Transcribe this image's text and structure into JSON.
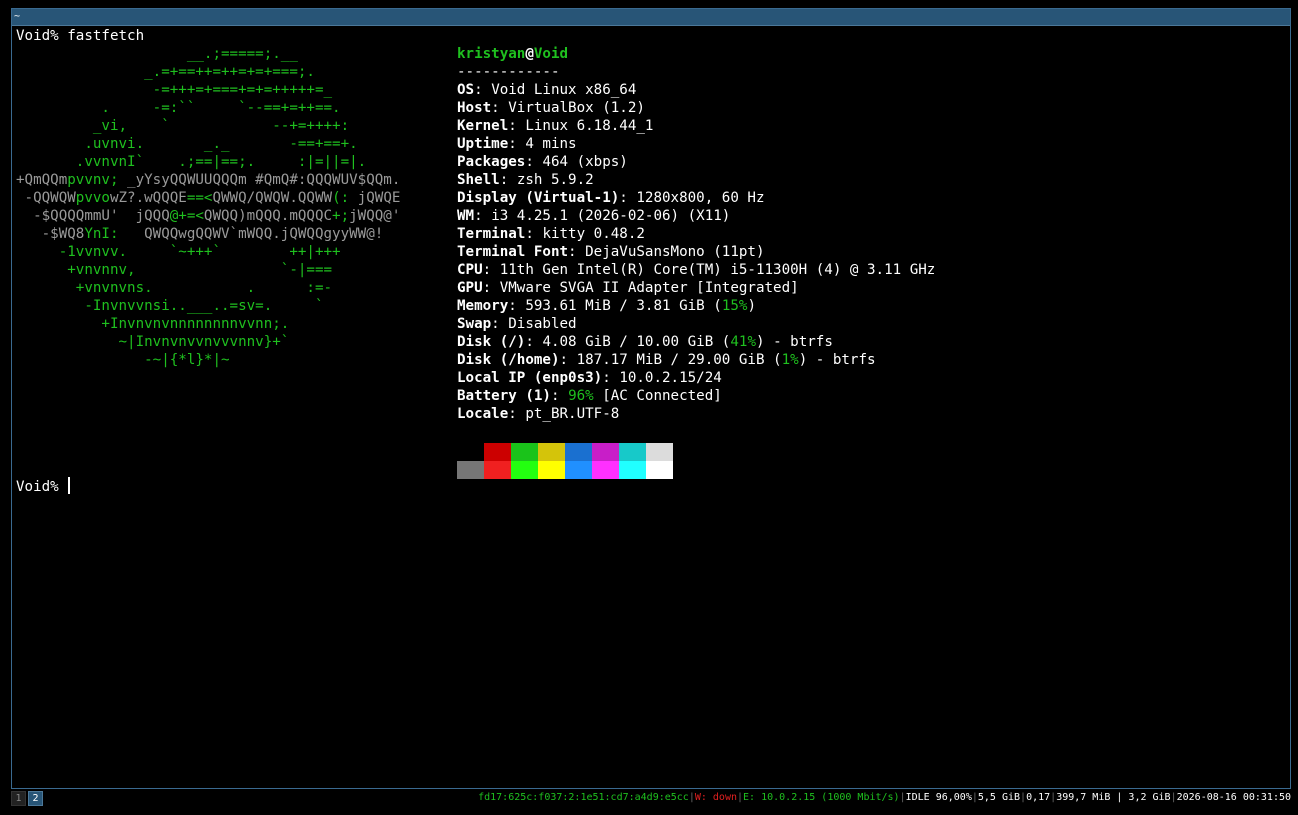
{
  "window": {
    "title": "~"
  },
  "terminal": {
    "prompt": "Void%",
    "command": "fastfetch",
    "prompt2": "Void%",
    "logo": [
      [
        {
          "t": "                    __.;=====;.__",
          "c": "g"
        }
      ],
      [
        {
          "t": "               _.=+==++=++=+=+===;.",
          "c": "g"
        }
      ],
      [
        {
          "t": "                -=+++=+===+=+=+++++=_",
          "c": "g"
        }
      ],
      [
        {
          "t": "          .     -=:``     `--==+=++==.",
          "c": "g"
        }
      ],
      [
        {
          "t": "         _vi,    `            --+=++++:",
          "c": "g"
        }
      ],
      [
        {
          "t": "        .uvnvi.       _._       -==+==+.",
          "c": "g"
        }
      ],
      [
        {
          "t": "       .vvnvnI`    .;==|==;.     :|=||=|.",
          "c": "g"
        }
      ],
      [
        {
          "t": "+QmQQm",
          "c": "w"
        },
        {
          "t": "pvvnv;",
          "c": "g"
        },
        {
          "t": " _yYsyQQWUUQQQm #QmQ#:QQQWUV$QQm.",
          "c": "w"
        }
      ],
      [
        {
          "t": " -QQWQW",
          "c": "w"
        },
        {
          "t": "pvvo",
          "c": "g"
        },
        {
          "t": "wZ?.wQQQE",
          "c": "w"
        },
        {
          "t": "==<",
          "c": "g"
        },
        {
          "t": "QWWQ/QWQW.QQWW",
          "c": "w"
        },
        {
          "t": "(:",
          "c": "g"
        },
        {
          "t": " jQWQE",
          "c": "w"
        }
      ],
      [
        {
          "t": "  -$QQQQmmU'  jQQQ",
          "c": "w"
        },
        {
          "t": "@+=<",
          "c": "g"
        },
        {
          "t": "QWQQ)mQQQ.mQQQC",
          "c": "w"
        },
        {
          "t": "+;",
          "c": "g"
        },
        {
          "t": "jWQQ@'",
          "c": "w"
        }
      ],
      [
        {
          "t": "   -$WQ8",
          "c": "w"
        },
        {
          "t": "YnI:",
          "c": "g"
        },
        {
          "t": "   QWQQwgQQWV`mWQQ.jQWQQgyyWW@!",
          "c": "w"
        }
      ],
      [
        {
          "t": "     -1vvnvv.     `~+++`        ++|+++",
          "c": "g"
        }
      ],
      [
        {
          "t": "      +vnvnnv,                 `-|===",
          "c": "g"
        }
      ],
      [
        {
          "t": "       +vnvnvns.           .      :=-",
          "c": "g"
        }
      ],
      [
        {
          "t": "        -Invnvvnsi..___..=sv=.     `",
          "c": "g"
        }
      ],
      [
        {
          "t": "          +Invnvnvnnnnnnnnvvnn;.",
          "c": "g"
        }
      ],
      [
        {
          "t": "            ~|Invnvnvvnvvvnnv}+`",
          "c": "g"
        }
      ],
      [
        {
          "t": "               -~|{*l}*|~",
          "c": "g"
        }
      ]
    ],
    "user": "kristyan",
    "at": "@",
    "host": "Void",
    "separator": "------------",
    "info": [
      {
        "key": "OS",
        "value": "Void Linux x86_64"
      },
      {
        "key": "Host",
        "value": "VirtualBox (1.2)"
      },
      {
        "key": "Kernel",
        "value": "Linux 6.18.44_1"
      },
      {
        "key": "Uptime",
        "value": "4 mins"
      },
      {
        "key": "Packages",
        "value": "464 (xbps)"
      },
      {
        "key": "Shell",
        "value": "zsh 5.9.2"
      },
      {
        "key": "Display (Virtual-1)",
        "value": "1280x800, 60 Hz"
      },
      {
        "key": "WM",
        "value": "i3 4.25.1 (2026-02-06) (X11)"
      },
      {
        "key": "Terminal",
        "value": "kitty 0.48.2"
      },
      {
        "key": "Terminal Font",
        "value": "DejaVuSansMono (11pt)"
      },
      {
        "key": "CPU",
        "value": "11th Gen Intel(R) Core(TM) i5-11300H (4) @ 3.11 GHz"
      },
      {
        "key": "GPU",
        "value": "VMware SVGA II Adapter [Integrated]"
      },
      {
        "key": "Memory",
        "value": "593.61 MiB / 3.81 GiB (",
        "pct": "15%",
        "after": ")"
      },
      {
        "key": "Swap",
        "value": "Disabled"
      },
      {
        "key": "Disk (/)",
        "value": "4.08 GiB / 10.00 GiB (",
        "pct": "41%",
        "after": ") - btrfs"
      },
      {
        "key": "Disk (/home)",
        "value": "187.17 MiB / 29.00 GiB (",
        "pct": "1%",
        "after": ") - btrfs"
      },
      {
        "key": "Local IP (enp0s3)",
        "value": "10.0.2.15/24"
      },
      {
        "key": "Battery (1)",
        "value": "",
        "pct": "96%",
        "after": " [AC Connected]"
      },
      {
        "key": "Locale",
        "value": "pt_BR.UTF-8"
      }
    ],
    "palette_top": [
      "#000000",
      "#cc0000",
      "#1ac31a",
      "#d4c40a",
      "#1a70d0",
      "#c81ec8",
      "#17c9c9",
      "#dcdcdc"
    ],
    "palette_bottom": [
      "#767676",
      "#f02020",
      "#23ff10",
      "#ffff00",
      "#2090ff",
      "#ff30ff",
      "#20ffff",
      "#ffffff"
    ]
  },
  "statusbar": {
    "workspaces": [
      "1",
      "2"
    ],
    "active_workspace": "2",
    "ipv6": "fd17:625c:f037:2:1e51:cd7:a4d9:e5cc",
    "wifi": "W: down",
    "ethernet": "E: 10.0.2.15 (1000 Mbit/s)",
    "cpu": "IDLE 96,00%",
    "disk": "5,5 GiB",
    "load": "0,17",
    "memory": "399,7 MiB | 3,2 GiB",
    "datetime": "2026-08-16 00:31:50"
  }
}
